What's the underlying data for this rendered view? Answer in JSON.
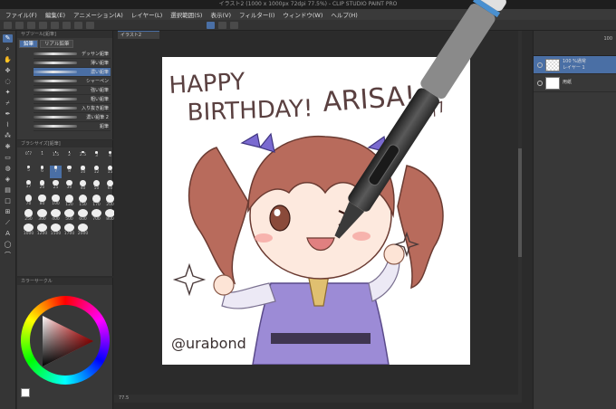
{
  "window": {
    "title": "イラスト2 (1000 x 1000px 72dpi 77.5%) - CLIP STUDIO PAINT PRO"
  },
  "menu": [
    "ファイル(F)",
    "編集(E)",
    "アニメーション(A)",
    "レイヤー(L)",
    "選択範囲(S)",
    "表示(V)",
    "フィルター(I)",
    "ウィンドウ(W)",
    "ヘルプ(H)"
  ],
  "subtool": {
    "header": "サブツール[鉛筆]",
    "tabs": [
      "鉛筆",
      "リアル鉛筆"
    ],
    "brushes": [
      "デッサン鉛筆",
      "薄い鉛筆",
      "濃い鉛筆",
      "シャーペン",
      "強い鉛筆",
      "粗い鉛筆",
      "入り抜き鉛筆",
      "濃い鉛筆 2",
      "鉛筆"
    ]
  },
  "brush_sizes": {
    "header": "ブラシサイズ[鉛筆]",
    "values": [
      "0.7",
      "1",
      "1.5",
      "2",
      "2.5",
      "3",
      "4",
      "5",
      "6",
      "7",
      "8",
      "10",
      "12",
      "15",
      "17",
      "20",
      "25",
      "30",
      "40",
      "50",
      "60",
      "70",
      "80",
      "100",
      "120",
      "150",
      "170",
      "200",
      "250",
      "300",
      "400",
      "500",
      "600",
      "700",
      "800",
      "1000",
      "1200",
      "1500",
      "1700",
      "2000"
    ],
    "selected": "7"
  },
  "color_panel": {
    "header": "カラーサークル"
  },
  "canvas": {
    "tab": "イラスト2",
    "text_birthday": [
      "HAPPY",
      "BIRTHDAY!"
    ],
    "text_name": "ARISA!",
    "text_date": "6/7",
    "signature": "@urabond"
  },
  "layers": {
    "opacity": "100",
    "items": [
      {
        "blend": "100 %通常",
        "name": "レイヤー 1"
      },
      {
        "blend": "",
        "name": "用紙"
      }
    ]
  },
  "status": {
    "zoom": "77.5"
  }
}
